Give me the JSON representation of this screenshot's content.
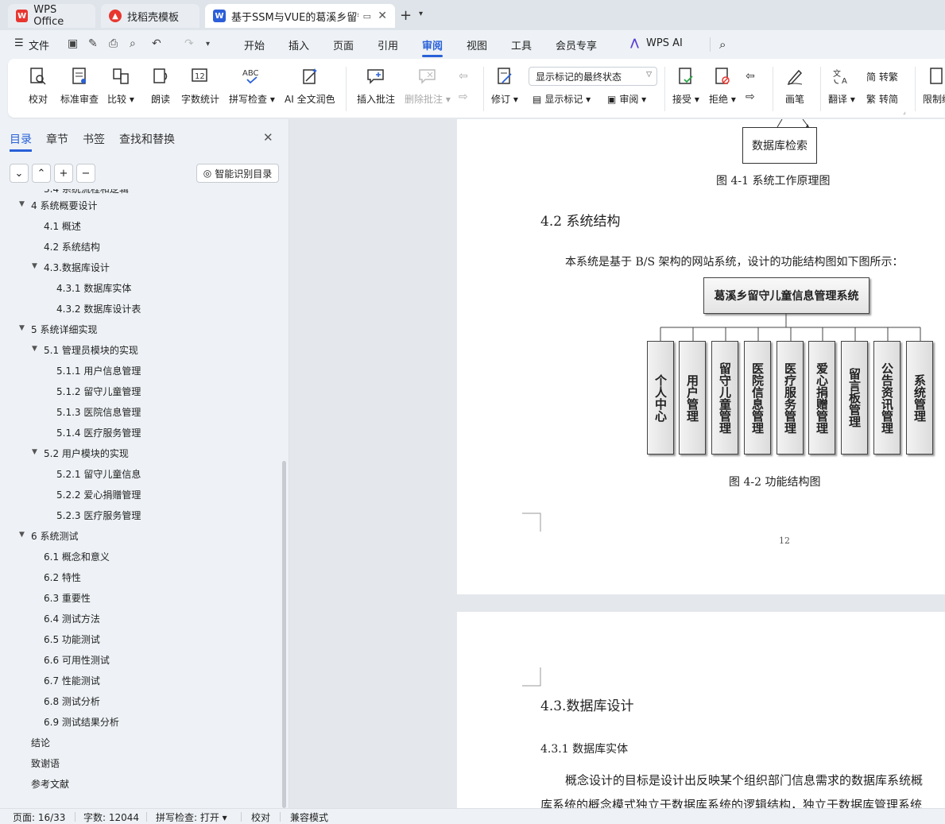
{
  "tabs": {
    "wps": "WPS Office",
    "template": "找稻壳模板",
    "doc": "基于SSM与VUE的葛溪乡留守"
  },
  "menu": {
    "file": "文件",
    "items": [
      "开始",
      "插入",
      "页面",
      "引用",
      "审阅",
      "视图",
      "工具",
      "会员专享"
    ],
    "ai": "WPS AI"
  },
  "ribbon": {
    "proof": "校对",
    "std_review": "标准审查",
    "compare": "比较",
    "read": "朗读",
    "word_count": "字数统计",
    "spell": "拼写检查",
    "ai_polish": "AI 全文润色",
    "insert_comment": "插入批注",
    "delete_comment": "删除批注",
    "revise": "修订",
    "display_markup": "显示标记",
    "review": "审阅",
    "markup_state": "显示标记的最终状态",
    "accept": "接受",
    "reject": "拒绝",
    "pen": "画笔",
    "translate": "翻译",
    "to_trad": "转繁",
    "to_simp": "转简",
    "restrict": "限制编"
  },
  "panel": {
    "tabs": [
      "目录",
      "章节",
      "书签",
      "查找和替换"
    ],
    "smart_toc": "智能识别目录",
    "toc": [
      {
        "text": "3.4 系统流程和逻辑",
        "level": 2
      },
      {
        "text": "4 系统概要设计",
        "level": 1,
        "arrow": true
      },
      {
        "text": "4.1 概述",
        "level": 2
      },
      {
        "text": "4.2 系统结构",
        "level": 2
      },
      {
        "text": "4.3.数据库设计",
        "level": 2,
        "arrow": true
      },
      {
        "text": "4.3.1 数据库实体",
        "level": 3
      },
      {
        "text": "4.3.2 数据库设计表",
        "level": 3
      },
      {
        "text": "5 系统详细实现",
        "level": 1,
        "arrow": true
      },
      {
        "text": "5.1  管理员模块的实现",
        "level": 2,
        "arrow": true
      },
      {
        "text": "5.1.1  用户信息管理",
        "level": 3
      },
      {
        "text": "5.1.2  留守儿童管理",
        "level": 3
      },
      {
        "text": "5.1.3  医院信息管理",
        "level": 3
      },
      {
        "text": "5.1.4  医疗服务管理",
        "level": 3
      },
      {
        "text": "5.2  用户模块的实现",
        "level": 2,
        "arrow": true
      },
      {
        "text": "5.2.1  留守儿童信息",
        "level": 3
      },
      {
        "text": "5.2.2  爱心捐赠管理",
        "level": 3
      },
      {
        "text": "5.2.3  医疗服务管理",
        "level": 3
      },
      {
        "text": "6 系统测试",
        "level": 1,
        "arrow": true
      },
      {
        "text": "6.1 概念和意义",
        "level": 2
      },
      {
        "text": "6.2 特性",
        "level": 2
      },
      {
        "text": "6.3 重要性",
        "level": 2
      },
      {
        "text": "6.4 测试方法",
        "level": 2
      },
      {
        "text": "6.5  功能测试",
        "level": 2
      },
      {
        "text": "6.6 可用性测试",
        "level": 2
      },
      {
        "text": "6.7 性能测试",
        "level": 2
      },
      {
        "text": "6.8 测试分析",
        "level": 2
      },
      {
        "text": "6.9 测试结果分析",
        "level": 2
      },
      {
        "text": "结论",
        "level": 1
      },
      {
        "text": "致谢语",
        "level": 1
      },
      {
        "text": "参考文献",
        "level": 1
      }
    ]
  },
  "doc": {
    "db_search_box": "数据库检索",
    "fig41": "图 4-1 系统工作原理图",
    "h42": "4.2 系统结构",
    "p42": "本系统是基于 B/S 架构的网站系统，设计的功能结构图如下图所示：",
    "root": "葛溪乡留守儿童信息管理系统",
    "modules": [
      "个人中心",
      "用户管理",
      "留守儿童管理",
      "医院信息管理",
      "医疗服务管理",
      "爱心捐赠管理",
      "留言板管理",
      "公告资讯管理",
      "系统管理"
    ],
    "fig42": "图 4-2 功能结构图",
    "page_number": "12",
    "h43": "4.3.数据库设计",
    "h431": "4.3.1 数据库实体",
    "p431_1": "概念设计的目标是设计出反映某个组织部门信息需求的数据库系统概",
    "p431_2": "库系统的概念模式独立于数据库系统的逻辑结构，独立于数据库管理系统"
  },
  "status": {
    "page": "页面: 16/33",
    "words": "字数: 12044",
    "spell": "拼写检查: 打开",
    "proof": "校对",
    "compat": "兼容模式"
  },
  "colors": {
    "accent": "#2860d8",
    "wps_red": "#e8362f",
    "doc_blue": "#2b5fd9"
  }
}
